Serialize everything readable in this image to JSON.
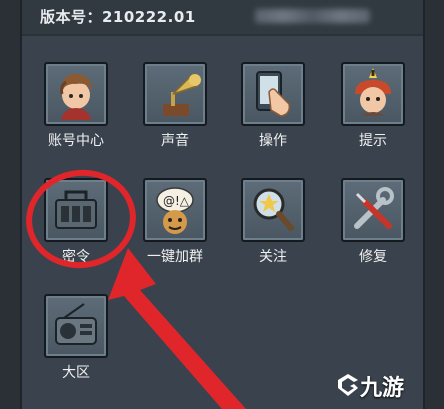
{
  "header": {
    "version_text": "版本号：210222.01"
  },
  "menu": {
    "items": [
      {
        "label": "账号中心",
        "icon": "account-avatar-icon"
      },
      {
        "label": "声音",
        "icon": "gramophone-icon"
      },
      {
        "label": "操作",
        "icon": "hand-phone-icon"
      },
      {
        "label": "提示",
        "icon": "tips-character-icon"
      },
      {
        "label": "密令",
        "icon": "radio-box-icon"
      },
      {
        "label": "一键加群",
        "icon": "chat-face-icon"
      },
      {
        "label": "关注",
        "icon": "magnifier-star-icon"
      },
      {
        "label": "修复",
        "icon": "wrench-screwdriver-icon"
      },
      {
        "label": "大区",
        "icon": "radio-server-icon"
      }
    ]
  },
  "annotation": {
    "circle_color": "#e0262a",
    "arrow_color": "#e0262a"
  },
  "watermark": {
    "text": "九游",
    "icon": "jiuyou-logo-icon"
  },
  "colors": {
    "panel": "#3a434d",
    "tile": "#55636f",
    "text": "#f0f0f0"
  }
}
